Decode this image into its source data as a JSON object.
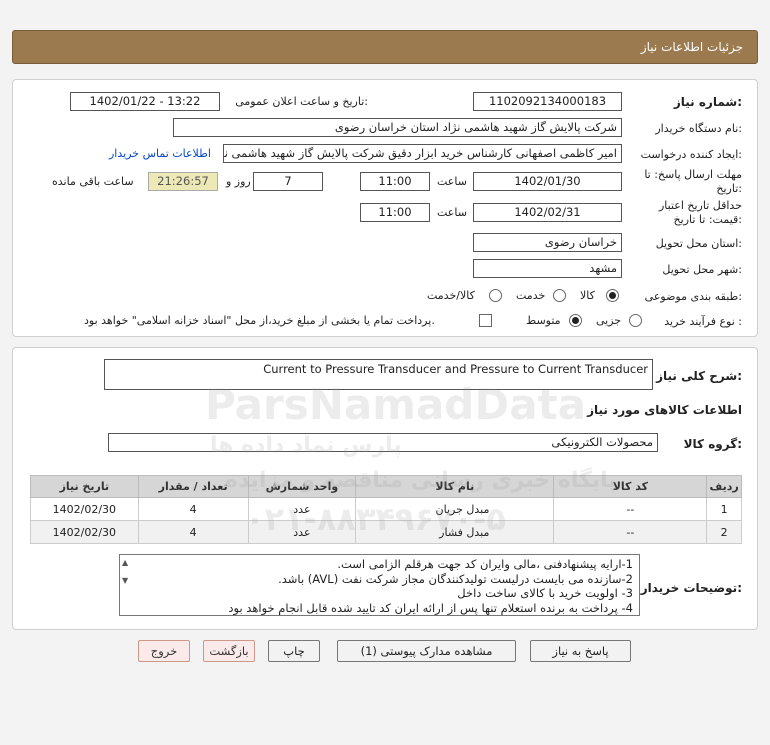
{
  "header": {
    "title": "جزئیات اطلاعات نیاز"
  },
  "fields": {
    "need_number_label": "شماره نیاز:",
    "need_number": "1102092134000183",
    "announce_label": "تاریخ و ساعت اعلان عمومی:",
    "announce_value": "1402/01/22 - 13:22",
    "buyer_org_label": "نام دستگاه خریدار:",
    "buyer_org": "شرکت پالایش گاز شهید هاشمی نژاد   استان خراسان رضوی",
    "creator_label": "ایجاد کننده درخواست:",
    "creator": "امیر کاظمی اصفهانی کارشناس خرید ابزار دقیق شرکت پالایش گاز شهید هاشمی نژاد",
    "contact_link": "اطلاعات تماس خریدار",
    "reply_deadline_label": "مهلت ارسال پاسخ: تا تاریخ:",
    "reply_date": "1402/01/30",
    "time_label": "ساعت",
    "reply_time": "11:00",
    "days_value": "7",
    "days_label": "روز و",
    "remaining_time": "21:26:57",
    "remaining_label": "ساعت باقی مانده",
    "validity_label": "حداقل تاریخ اعتبار قیمت: تا تاریخ:",
    "validity_date": "1402/02/31",
    "validity_time_label": "ساعت",
    "validity_time": "11:00",
    "province_label": "استان محل تحویل:",
    "province": "خراسان رضوی",
    "city_label": "شهر محل تحویل:",
    "city": "مشهد",
    "category_label": "طبقه بندی موضوعی:",
    "category_options": [
      "کالا",
      "خدمت",
      "کالا/خدمت"
    ],
    "process_label": "نوع فرآیند خرید :",
    "process_options": [
      "جزیی",
      "متوسط"
    ],
    "payment_note": "پرداخت تمام یا بخشی از مبلغ خرید،از محل \"اسناد خزانه اسلامی\" خواهد بود."
  },
  "description": {
    "label": "شرح کلی نیاز:",
    "value": "Current to Pressure Transducer and Pressure to Current Transducer"
  },
  "goods_info": {
    "title": "اطلاعات کالاهای مورد نیاز",
    "group_label": "گروه کالا:",
    "group_value": "محصولات الکترونیکی"
  },
  "table": {
    "headers": [
      "ردیف",
      "کد کالا",
      "نام کالا",
      "واحد شمارش",
      "تعداد / مقدار",
      "تاریخ نیاز"
    ],
    "rows": [
      [
        "1",
        "--",
        "مبدل جریان",
        "عدد",
        "4",
        "1402/02/30"
      ],
      [
        "2",
        "--",
        "مبدل فشار",
        "عدد",
        "4",
        "1402/02/30"
      ]
    ]
  },
  "buyer_notes": {
    "label": "توضیحات خریدار:",
    "lines": [
      "1-ارایه پیشنهادفنی ،مالی وایران کد جهت هرقلم الزامی است.",
      "2-سازنده می بایست درلیست تولیدکنندگان مجاز شرکت نفت (AVL)  باشد.",
      "3- اولویت خرید با کالای ساخت داخل",
      "4- پرداخت به برنده استعلام تنها پس از ارائه ایران کد تایید شده قابل انجام خواهد بود"
    ]
  },
  "buttons": {
    "reply": "پاسخ به نیاز",
    "attachments": "مشاهده مدارک پیوستی (1)",
    "print": "چاپ",
    "back": "بازگشت",
    "exit": "خروج"
  },
  "watermark": {
    "brand": "ParsNamadData",
    "fa1": "پارس نماد داده ها",
    "fa2": "پایگاه خبری رسانی مناقصه و مزایده",
    "phone": "۰۲۱-۸۸۳۴۹۶۷۰-۵"
  },
  "colors": {
    "header": "#9c7a4f",
    "timer_bg": "#ece9b6",
    "link": "#0645c8"
  }
}
